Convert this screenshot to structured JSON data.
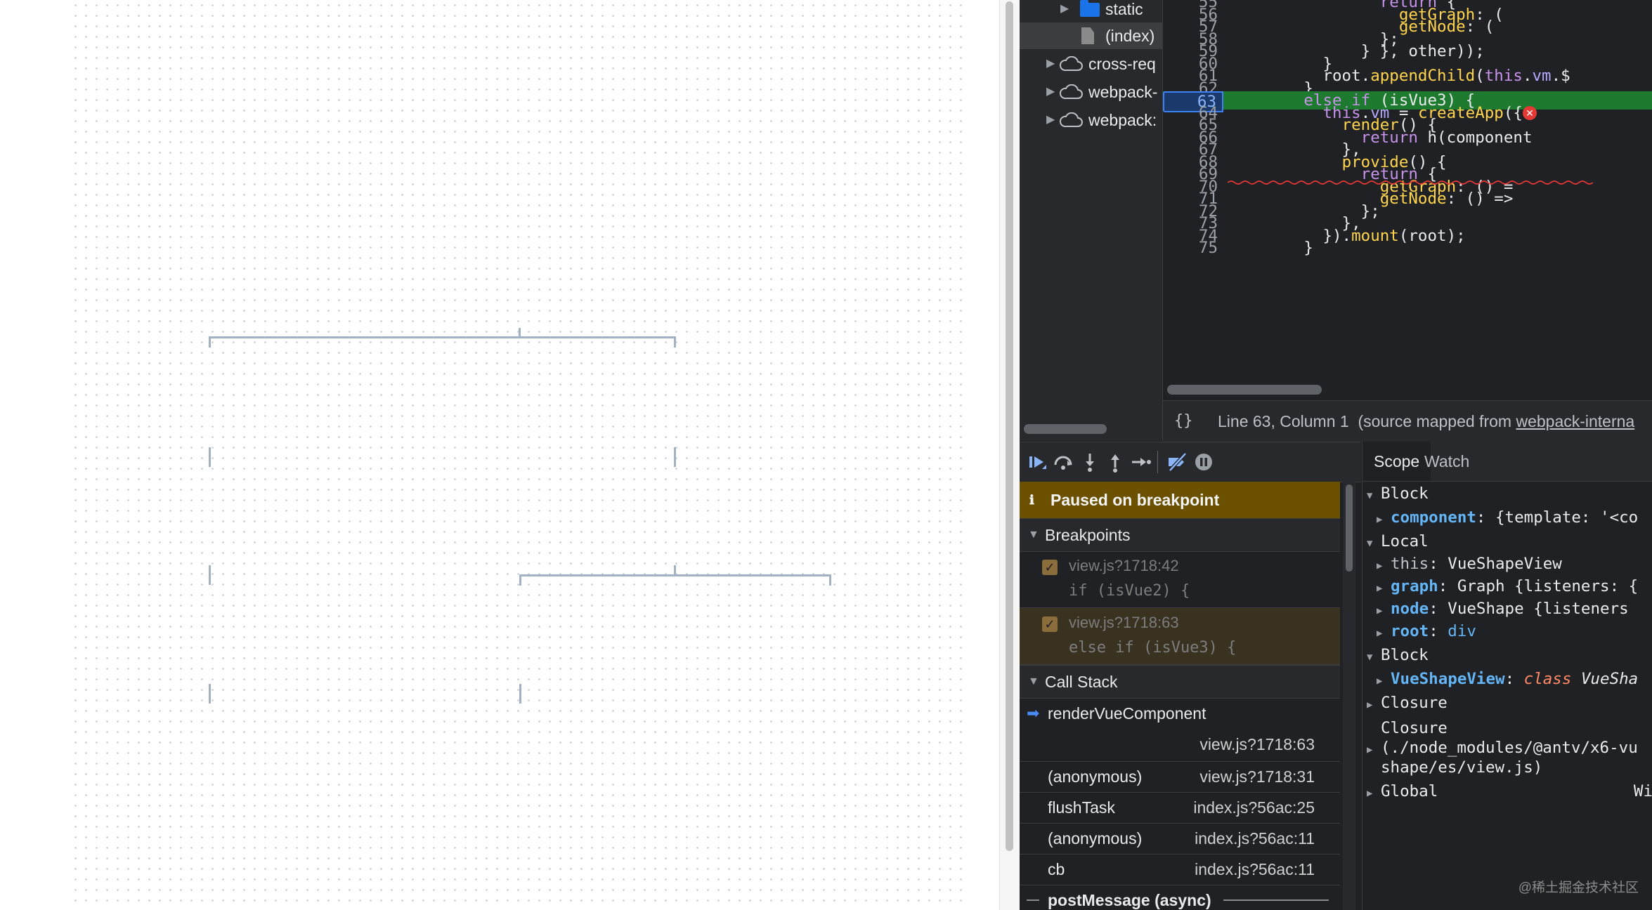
{
  "navigator": {
    "items": [
      {
        "label": "static",
        "icon": "folder-icon"
      },
      {
        "label": "(index)",
        "icon": "file-icon"
      },
      {
        "label": "cross-req",
        "icon": "cloud-icon"
      },
      {
        "label": "webpack-",
        "icon": "cloud-icon"
      },
      {
        "label": "webpack:",
        "icon": "cloud-icon"
      }
    ]
  },
  "editor": {
    "lines": [
      {
        "n": "55",
        "code": "                return {"
      },
      {
        "n": "56",
        "code": "                  getGraph: ("
      },
      {
        "n": "57",
        "code": "                  getNode: ("
      },
      {
        "n": "58",
        "code": "                };"
      },
      {
        "n": "59",
        "code": "              } }, other));"
      },
      {
        "n": "60",
        "code": "          }"
      },
      {
        "n": "61",
        "code": "          root.appendChild(this.vm.$"
      },
      {
        "n": "62",
        "code": "        }"
      },
      {
        "n": "63",
        "code": "        else if (isVue3) {"
      },
      {
        "n": "64",
        "code": "          this.vm = createApp({"
      },
      {
        "n": "65",
        "code": "            render() {"
      },
      {
        "n": "66",
        "code": "              return h(component"
      },
      {
        "n": "67",
        "code": "            },"
      },
      {
        "n": "68",
        "code": "            provide() {"
      },
      {
        "n": "69",
        "code": "              return {"
      },
      {
        "n": "70",
        "code": "                getGraph: () ="
      },
      {
        "n": "71",
        "code": "                getNode: () =>"
      },
      {
        "n": "72",
        "code": "              };"
      },
      {
        "n": "73",
        "code": "            },"
      },
      {
        "n": "74",
        "code": "          }).mount(root);"
      },
      {
        "n": "75",
        "code": "        }"
      }
    ],
    "error_badge": "✕"
  },
  "status": {
    "braces": "{}",
    "position": "Line 63, Column 1",
    "source_prefix": "(source mapped from ",
    "source_link": "webpack-interna"
  },
  "paused": {
    "icon": "info-icon",
    "text": "Paused on breakpoint"
  },
  "breakpoints": {
    "title": "Breakpoints",
    "items": [
      {
        "file": "view.js?1718:42",
        "code": "if (isVue2) {"
      },
      {
        "file": "view.js?1718:63",
        "code": "else if (isVue3) {"
      }
    ]
  },
  "callstack": {
    "title": "Call Stack",
    "frames": [
      {
        "fn": "renderVueComponent",
        "loc": "view.js?1718:63"
      },
      {
        "fn": "(anonymous)",
        "loc": "view.js?1718:31"
      },
      {
        "fn": "flushTask",
        "loc": "index.js?56ac:25"
      },
      {
        "fn": "(anonymous)",
        "loc": "index.js?56ac:11"
      },
      {
        "fn": "cb",
        "loc": "index.js?56ac:11"
      }
    ],
    "async_label": "postMessage (async)"
  },
  "tabs": {
    "scope": "Scope",
    "watch": "Watch"
  },
  "scope": {
    "block1": "Block",
    "component_key": "component",
    "component_val": "{template: '<co",
    "local": "Local",
    "this_key": "this",
    "this_val": "VueShapeView",
    "graph_key": "graph",
    "graph_val": "Graph {listeners: {",
    "node_key": "node",
    "node_val": "VueShape {listeners",
    "root_key": "root",
    "root_val": "div",
    "block2": "Block",
    "vsv_key": "VueShapeView",
    "vsv_class": "class",
    "vsv_name": "VueSha",
    "closure": "Closure",
    "closure2_title": "Closure",
    "closure2_path1": "(./node_modules/@antv/x6-vu",
    "closure2_path2": "shape/es/view.js)",
    "global": "Global",
    "global_val": "Wi"
  },
  "watermark": "@稀土掘金技术社区"
}
